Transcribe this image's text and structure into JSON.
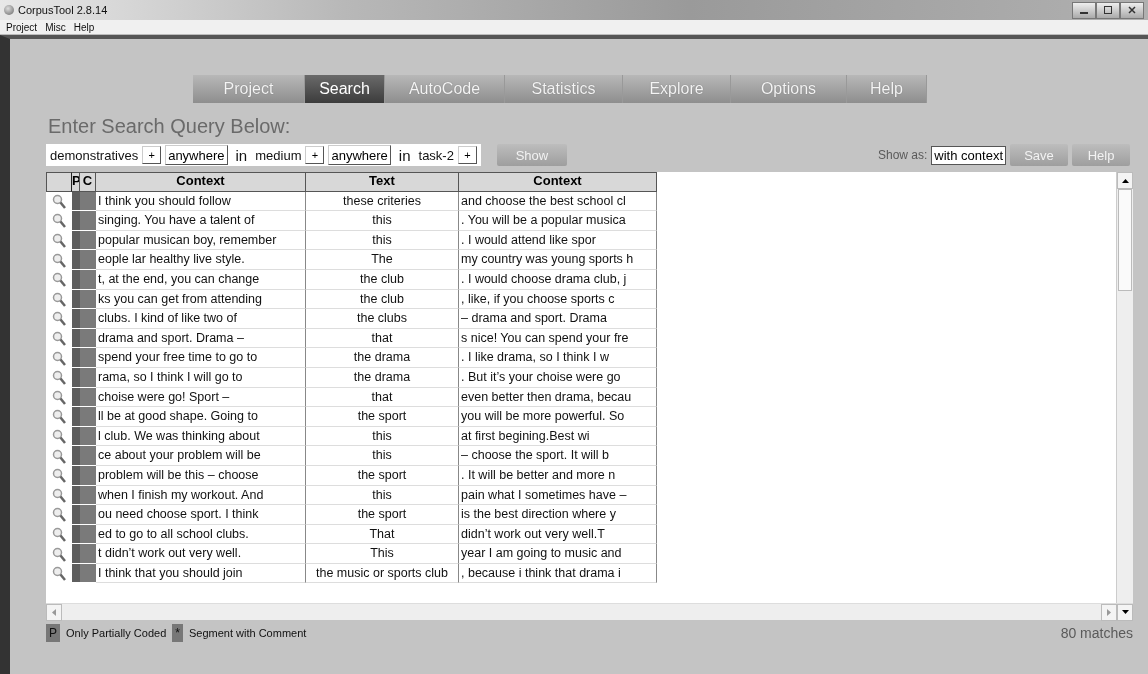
{
  "window": {
    "title": "CorpusTool 2.8.14"
  },
  "menu": [
    "Project",
    "Misc",
    "Help"
  ],
  "tabs": [
    {
      "label": "Project",
      "selected": false
    },
    {
      "label": "Search",
      "selected": true
    },
    {
      "label": "AutoCode",
      "selected": false
    },
    {
      "label": "Statistics",
      "selected": false
    },
    {
      "label": "Explore",
      "selected": false
    },
    {
      "label": "Options",
      "selected": false
    },
    {
      "label": "Help",
      "selected": false
    }
  ],
  "heading": "Enter Search Query Below:",
  "query": [
    {
      "kind": "text",
      "text": "demonstratives"
    },
    {
      "kind": "plus",
      "text": "+"
    },
    {
      "kind": "field",
      "text": "anywhere"
    },
    {
      "kind": "in",
      "text": "in"
    },
    {
      "kind": "text",
      "text": "medium"
    },
    {
      "kind": "plus",
      "text": "+"
    },
    {
      "kind": "field",
      "text": "anywhere"
    },
    {
      "kind": "in",
      "text": "in"
    },
    {
      "kind": "text",
      "text": "task-2"
    },
    {
      "kind": "plus",
      "text": "+"
    }
  ],
  "show_button": "Show",
  "show_as": {
    "label": "Show as:",
    "value": "with context"
  },
  "buttons": [
    "Save",
    "Help"
  ],
  "table": {
    "flag_columns": [
      "P",
      "C"
    ],
    "columns": [
      "Context",
      "Text",
      "Context"
    ],
    "rows": [
      [
        "I think you should follow",
        "these criteries",
        "and choose the best school cl"
      ],
      [
        "singing. You have a talent of",
        "this",
        ". You will be a popular musica"
      ],
      [
        "popular musican boy, remember",
        "this",
        ".  I would attend like spor"
      ],
      [
        "eople lar healthy live style.",
        "The",
        "my country was young sports h"
      ],
      [
        "t, at the end, you can change",
        "the club",
        ". I would choose drama club, j"
      ],
      [
        "ks you can get from attending",
        "the club",
        ", like, if you choose sports c"
      ],
      [
        "clubs. I kind of like two of",
        "the clubs",
        "– drama and sport.  Drama"
      ],
      [
        "drama and sport.  Drama –",
        "that",
        "s nice! You can spend your fre"
      ],
      [
        "spend your free time to go to",
        "the drama",
        ". I like drama, so I think I w"
      ],
      [
        "rama, so I think I will go to",
        "the drama",
        ". But it’s your choise were go"
      ],
      [
        "choise were go!  Sport –",
        "that",
        "even better then drama, becau"
      ],
      [
        "ll be at good shape. Going to",
        "the sport",
        "you will be more powerful. So"
      ],
      [
        "l club. We was thinking about",
        "this",
        "at first begining.Best wi"
      ],
      [
        "ce about your problem will be",
        "this",
        "– choose the sport. It will b"
      ],
      [
        "problem will be this – choose",
        "the sport",
        ". It will be better and more n"
      ],
      [
        "when I finish my workout. And",
        "this",
        "pain what I sometimes have –"
      ],
      [
        "ou need choose sport. I think",
        "the sport",
        "is the best direction where y"
      ],
      [
        "ed to go to all school clubs.",
        "That",
        "didn’t work out very well.T"
      ],
      [
        "t didn’t work out very well.",
        "This",
        "year I am going to music and"
      ],
      [
        "I think that you should join",
        "the music or sports club",
        ", because i think that drama i"
      ]
    ]
  },
  "legend": [
    {
      "key": "P",
      "label": "Only Partially Coded"
    },
    {
      "key": "*",
      "label": "Segment with Comment"
    }
  ],
  "match_count": "80 matches"
}
